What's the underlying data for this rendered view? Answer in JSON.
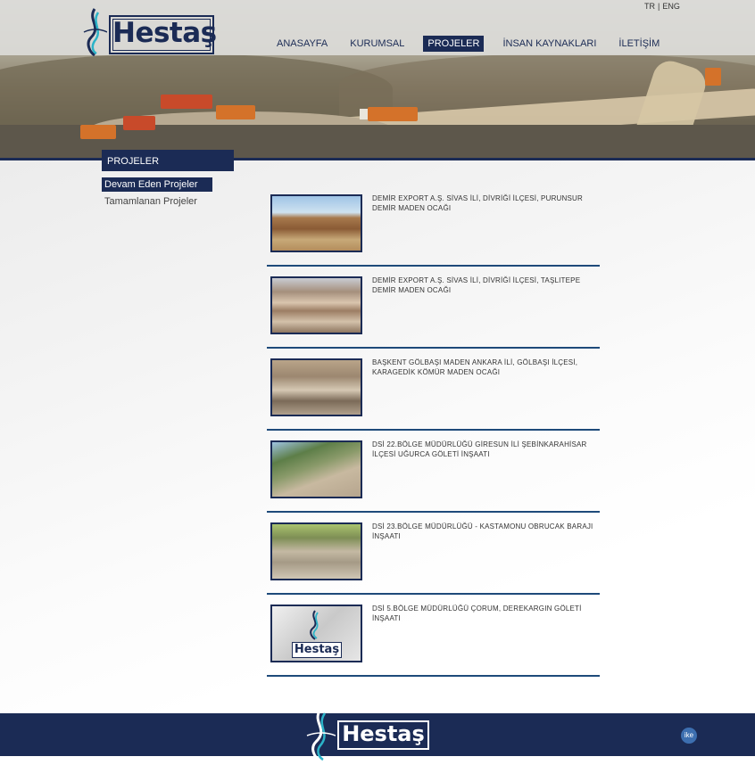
{
  "header": {
    "logo_text": "Hestaş",
    "lang": {
      "tr": "TR",
      "separator": "|",
      "eng": "ENG"
    },
    "nav": [
      {
        "label": "ANASAYFA",
        "active": false
      },
      {
        "label": "KURUMSAL",
        "active": false
      },
      {
        "label": "PROJELER",
        "active": true
      },
      {
        "label": "İNSAN KAYNAKLARI",
        "active": false
      },
      {
        "label": "İLETİŞİM",
        "active": false
      }
    ]
  },
  "sidebar": {
    "heading": "PROJELER",
    "items": [
      {
        "label": "Devam Eden Projeler",
        "active": true
      },
      {
        "label": "Tamamlanan Projeler",
        "active": false
      }
    ]
  },
  "projects": [
    {
      "title": "DEMİR EXPORT A.Ş. SİVAS İLİ, DİVRİĞİ İLÇESİ, PURUNSUR DEMİR MADEN OCAĞI"
    },
    {
      "title": "DEMİR EXPORT A.Ş. SİVAS İLİ, DİVRİĞİ İLÇESİ, TAŞLITEPE DEMİR MADEN OCAĞI"
    },
    {
      "title": "BAŞKENT GÖLBAŞI MADEN ANKARA İLİ, GÖLBAŞI İLÇESİ, KARAGEDİK KÖMÜR MADEN OCAĞI"
    },
    {
      "title": "DSİ 22.BÖLGE MÜDÜRLÜĞÜ GİRESUN İLİ ŞEBİNKARAHİSAR İLÇESİ UĞURCA GÖLETİ İNŞAATI"
    },
    {
      "title": "DSİ 23.BÖLGE MÜDÜRLÜĞÜ - KASTAMONU OBRUCAK BARAJI İNŞAATI"
    },
    {
      "title": "DSİ 5.BÖLGE MÜDÜRLÜĞÜ ÇORUM, DEREKARGIN GÖLETİ İNŞAATI",
      "thumb_logo_text": "Hestaş"
    }
  ],
  "footer": {
    "logo_text": "Hestaş",
    "badge": "ike"
  },
  "colors": {
    "brand_navy": "#1b2b55",
    "rule_blue": "#1e4a7a",
    "logo_accent": "#2bb3c8"
  }
}
